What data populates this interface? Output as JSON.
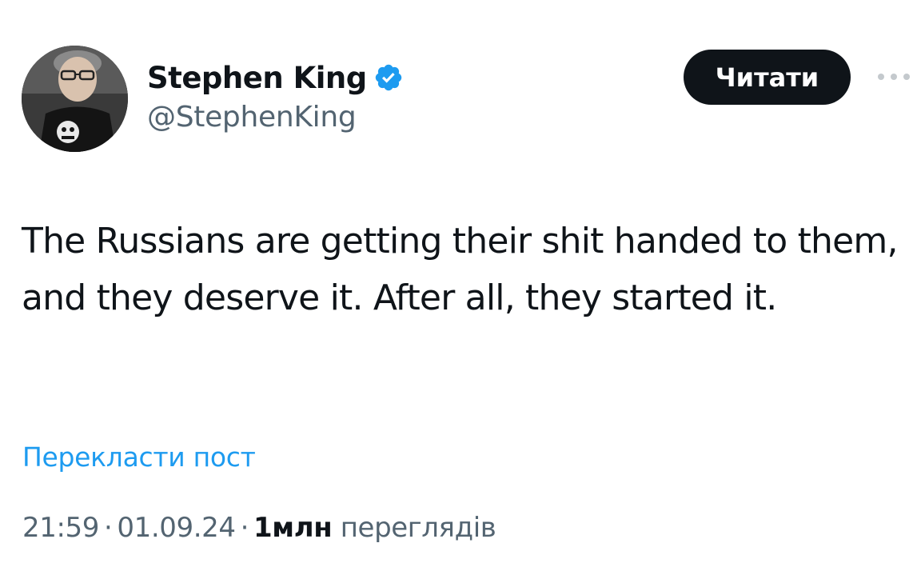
{
  "author": {
    "display_name": "Stephen King",
    "handle": "@StephenKing",
    "verified_icon": "verified-badge-icon",
    "avatar_icon": "profile-photo"
  },
  "actions": {
    "follow_label": "Читати",
    "more_icon": "more-dots-icon"
  },
  "tweet": {
    "text": "The Russians are getting their shit handed to them, and they deserve it. After all, they started it.",
    "translate_label": "Перекласти пост"
  },
  "meta": {
    "time": "21:59",
    "separator": "·",
    "date": "01.09.24",
    "views_count": "1млн",
    "views_label": "переглядів"
  },
  "colors": {
    "text": "#0f1419",
    "secondary": "#536471",
    "link": "#1d9bf0",
    "verified": "#1d9bf0",
    "button_bg": "#0f1419"
  }
}
